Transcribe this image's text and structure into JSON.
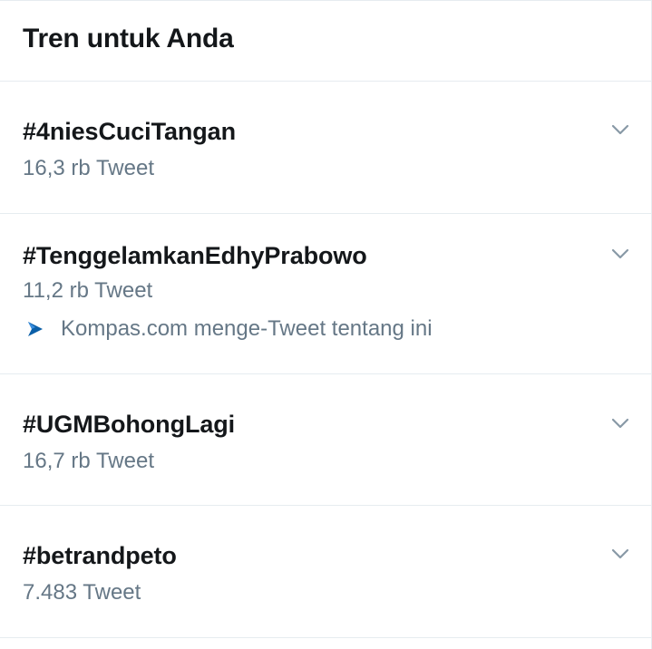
{
  "header": {
    "title": "Tren untuk Anda"
  },
  "trends": [
    {
      "name": "#4niesCuciTangan",
      "count": "16,3 rb Tweet"
    },
    {
      "name": "#TenggelamkanEdhyPrabowo",
      "count": "11,2 rb Tweet",
      "context": "Kompas.com menge-Tweet tentang ini",
      "context_icon": "kompas-logo-icon"
    },
    {
      "name": "#UGMBohongLagi",
      "count": "16,7 rb Tweet"
    },
    {
      "name": "#betrandpeto",
      "count": "7.483 Tweet"
    }
  ],
  "icons": {
    "more": "chevron-down-icon"
  },
  "colors": {
    "text_primary": "#14171a",
    "text_secondary": "#657786",
    "divider": "#e6ecf0",
    "chevron": "#8899a6",
    "kompas_blue": "#0b5fa8"
  }
}
